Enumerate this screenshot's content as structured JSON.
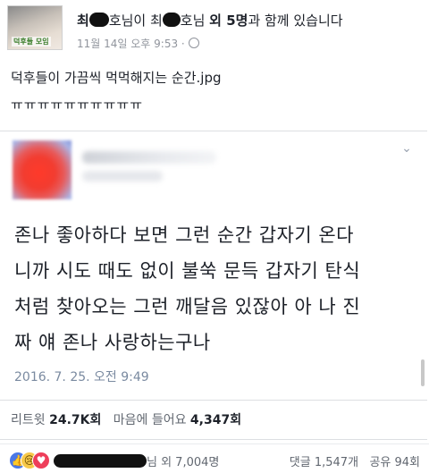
{
  "post": {
    "header": {
      "author_start": "최",
      "author_mid_1": "호님이 최",
      "author_mid_2": "호님",
      "others": "외 5명",
      "suffix": "과 함께 있습니다",
      "time": "11월 14일 오후 9:53 ·",
      "avatar_caption": "덕후들 모임"
    },
    "text_line1": "덕후들이 가끔씩 먹먹해지는 순간.jpg",
    "text_line2": "ㅠㅠㅠㅠㅠㅠㅠㅠㅠㅠ"
  },
  "tweet": {
    "chevron": "⌄",
    "body_line1": "존나 좋아하다 보면 그런 순간 갑자기 온다",
    "body_line2": "니까 시도 때도 없이 불쑥 문득 갑자기 탄식",
    "body_line3": "처럼 찾아오는 그런 깨달음 있잖아 아 나 진",
    "body_line4": "짜 얘 존나 사랑하는구나",
    "date": "2016. 7. 25. 오전 9:49",
    "retweets_label": "리트윗",
    "retweets_value": "24.7K회",
    "likes_label": "마음에 들어요",
    "likes_value": "4,347회"
  },
  "reactions": {
    "icons": [
      "like-icon",
      "sad-icon",
      "love-icon"
    ],
    "like_glyph": "👍",
    "sad_glyph": "😢",
    "love_glyph": "♥",
    "names_suffix": "님 외 7,004명",
    "comments": "댓글 1,547개",
    "shares": "공유 94회"
  }
}
